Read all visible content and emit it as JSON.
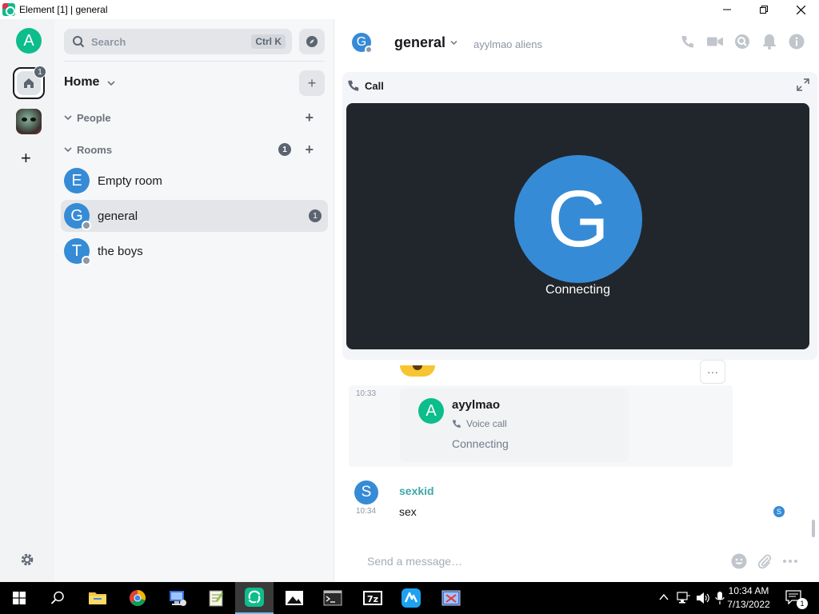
{
  "window": {
    "title": "Element [1] | general"
  },
  "spaces": {
    "user_initial": "A",
    "home_badge": "1",
    "add_label": "+"
  },
  "roomlist": {
    "search_label": "Search",
    "search_shortcut": "Ctrl K",
    "home_title": "Home",
    "add_label": "+",
    "sections": {
      "people": "People",
      "rooms": "Rooms",
      "rooms_badge": "1"
    },
    "rooms": [
      {
        "initial": "E",
        "name": "Empty room"
      },
      {
        "initial": "G",
        "name": "general",
        "badge": "1"
      },
      {
        "initial": "T",
        "name": "the boys"
      }
    ]
  },
  "room": {
    "initial": "G",
    "name": "general",
    "topic": "ayylmao aliens"
  },
  "call": {
    "label": "Call",
    "avatar_initial": "G",
    "status": "Connecting"
  },
  "timeline": {
    "more_label": "···",
    "msg1": {
      "time": "10:33",
      "initial": "A",
      "sender": "ayylmao",
      "call_type": "Voice call",
      "call_status": "Connecting"
    },
    "msg2": {
      "time": "10:34",
      "initial": "S",
      "sender": "sexkid",
      "body": "sex",
      "receipt_initial": "S"
    }
  },
  "composer": {
    "placeholder": "Send a message…"
  },
  "taskbar": {
    "time": "10:34 AM",
    "date": "7/13/2022",
    "notification_count": "1"
  },
  "colors": {
    "accent": "#0dbd8b",
    "avatar_blue": "#368bd6",
    "call_bg": "#21262c",
    "sender_teal": "#3fa7a7"
  }
}
